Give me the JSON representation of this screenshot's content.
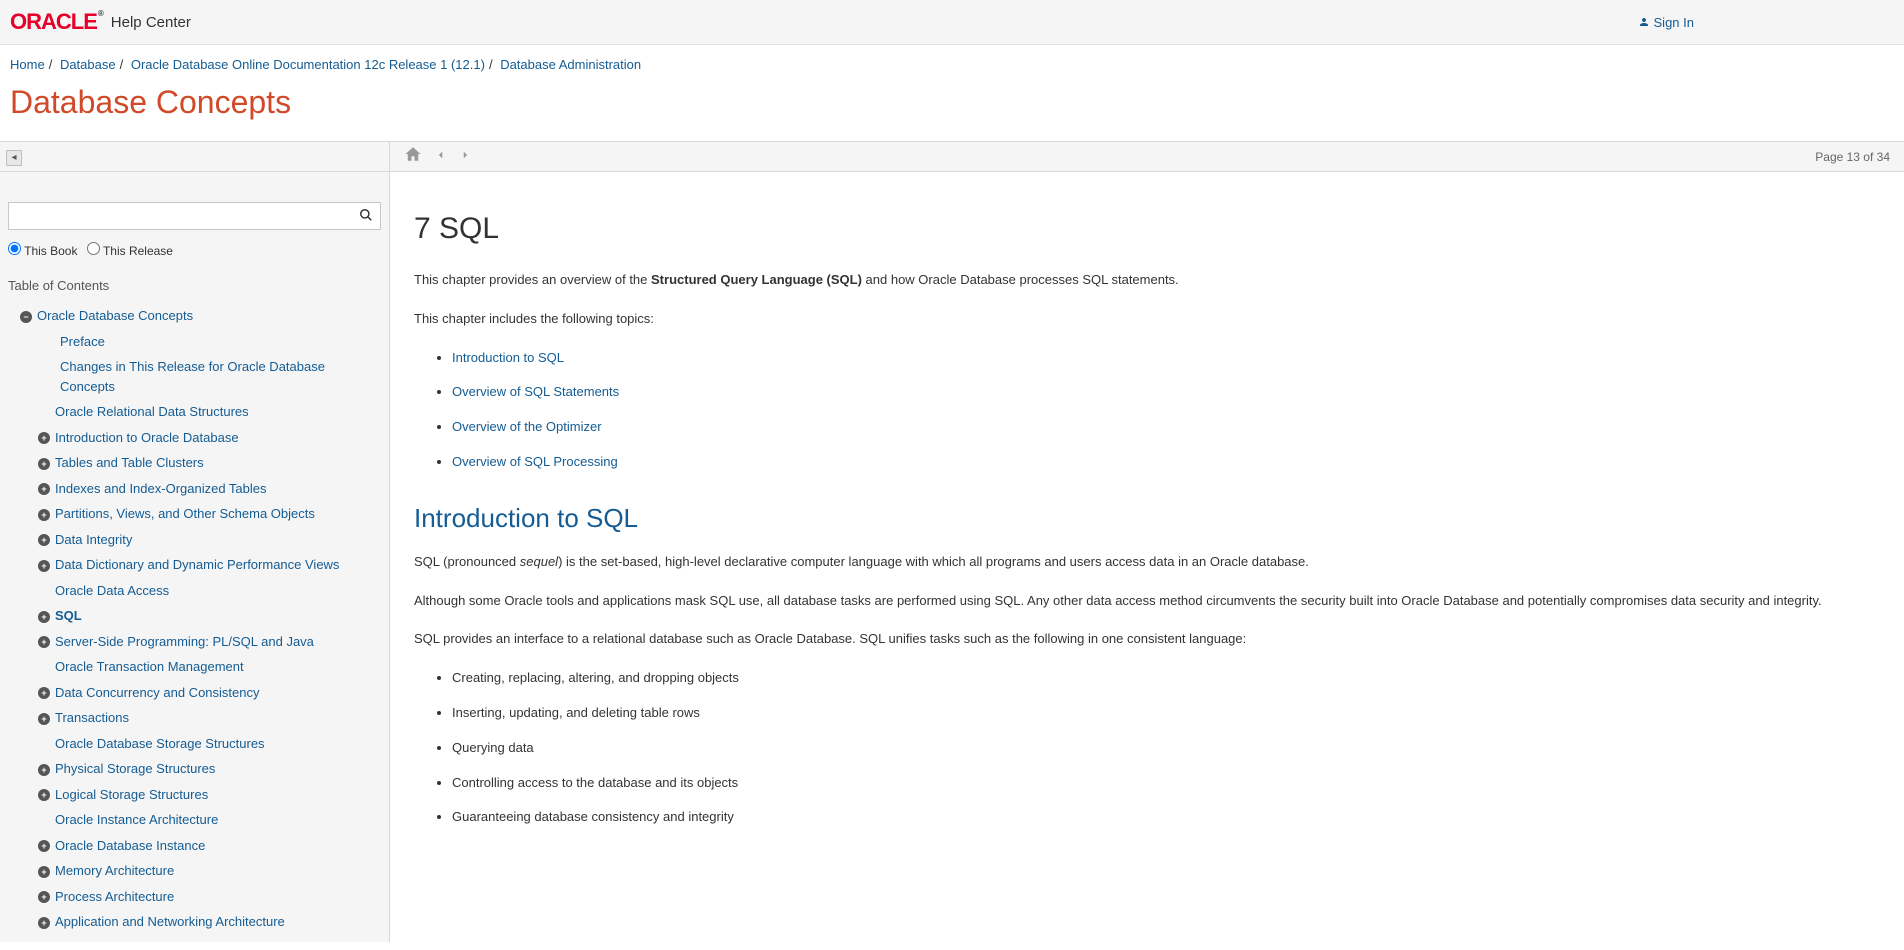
{
  "header": {
    "logo": "ORACLE",
    "helpcenter": "Help Center",
    "signin": "Sign In"
  },
  "breadcrumb": {
    "home": "Home",
    "database": "Database",
    "release": "Oracle Database Online Documentation 12c Release 1 (12.1)",
    "admin": "Database Administration"
  },
  "page_title": "Database Concepts",
  "search": {
    "this_book": "This Book",
    "this_release": "This Release"
  },
  "toc_title": "Table of Contents",
  "toc": {
    "root": "Oracle Database Concepts",
    "preface": "Preface",
    "changes": "Changes in This Release for Oracle Database Concepts",
    "relational": "Oracle Relational Data Structures",
    "intro": "Introduction to Oracle Database",
    "tables": "Tables and Table Clusters",
    "indexes": "Indexes and Index-Organized Tables",
    "partitions": "Partitions, Views, and Other Schema Objects",
    "integrity": "Data Integrity",
    "dictionary": "Data Dictionary and Dynamic Performance Views",
    "access": "Oracle Data Access",
    "sql": "SQL",
    "serverside": "Server-Side Programming: PL/SQL and Java",
    "txmgmt": "Oracle Transaction Management",
    "concurrency": "Data Concurrency and Consistency",
    "transactions": "Transactions",
    "storage": "Oracle Database Storage Structures",
    "physical": "Physical Storage Structures",
    "logical": "Logical Storage Structures",
    "instance_arch": "Oracle Instance Architecture",
    "db_instance": "Oracle Database Instance",
    "memory": "Memory Architecture",
    "process": "Process Architecture",
    "appnet": "Application and Networking Architecture"
  },
  "content": {
    "page_indicator": "Page 13 of 34",
    "h1": "7 SQL",
    "intro_p1a": "This chapter provides an overview of the ",
    "intro_p1b": "Structured Query Language (SQL)",
    "intro_p1c": " and how Oracle Database processes SQL statements.",
    "intro_p2": "This chapter includes the following topics:",
    "links": {
      "l1": "Introduction to SQL",
      "l2": "Overview of SQL Statements",
      "l3": "Overview of the Optimizer",
      "l4": "Overview of SQL Processing"
    },
    "h2": "Introduction to SQL",
    "p3a": "SQL (pronounced ",
    "p3b": "sequel",
    "p3c": ") is the set-based, high-level declarative computer language with which all programs and users access data in an Oracle database.",
    "p4": "Although some Oracle tools and applications mask SQL use, all database tasks are performed using SQL. Any other data access method circumvents the security built into Oracle Database and potentially compromises data security and integrity.",
    "p5": "SQL provides an interface to a relational database such as Oracle Database. SQL unifies tasks such as the following in one consistent language:",
    "tasks": {
      "t1": "Creating, replacing, altering, and dropping objects",
      "t2": "Inserting, updating, and deleting table rows",
      "t3": "Querying data",
      "t4": "Controlling access to the database and its objects",
      "t5": "Guaranteeing database consistency and integrity"
    }
  }
}
